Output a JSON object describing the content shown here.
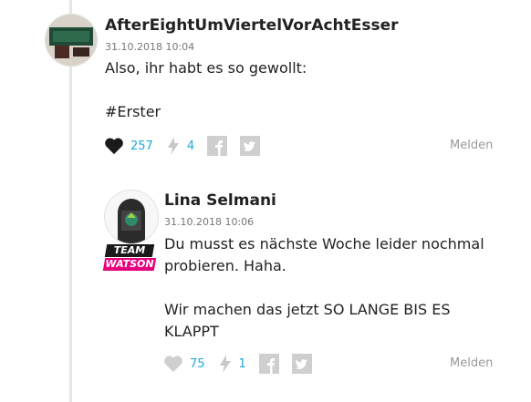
{
  "comments": [
    {
      "author": "AfterEightUmViertelVorAchtEsser",
      "date": "31.10.2018 10:04",
      "text": "Also, ihr habt es so gewollt:\n\n#Erster",
      "likes": "257",
      "flashes": "4",
      "report_label": "Melden",
      "icons": [
        "heart-icon",
        "flash-icon",
        "facebook-icon",
        "twitter-icon"
      ]
    },
    {
      "author": "Lina Selmani",
      "date": "31.10.2018 10:06",
      "text": "Du musst es nächste Woche leider nochmal probieren. Haha.\n\nWir machen das jetzt SO LANGE BIS ES KLAPPT",
      "likes": "75",
      "flashes": "1",
      "report_label": "Melden",
      "badge_line1": "TEAM",
      "badge_line2": "WATSON",
      "icons": [
        "heart-icon",
        "flash-icon",
        "facebook-icon",
        "twitter-icon"
      ]
    }
  ],
  "colors": {
    "accent": "#20a8d8",
    "badge_pink": "#e6007e"
  }
}
